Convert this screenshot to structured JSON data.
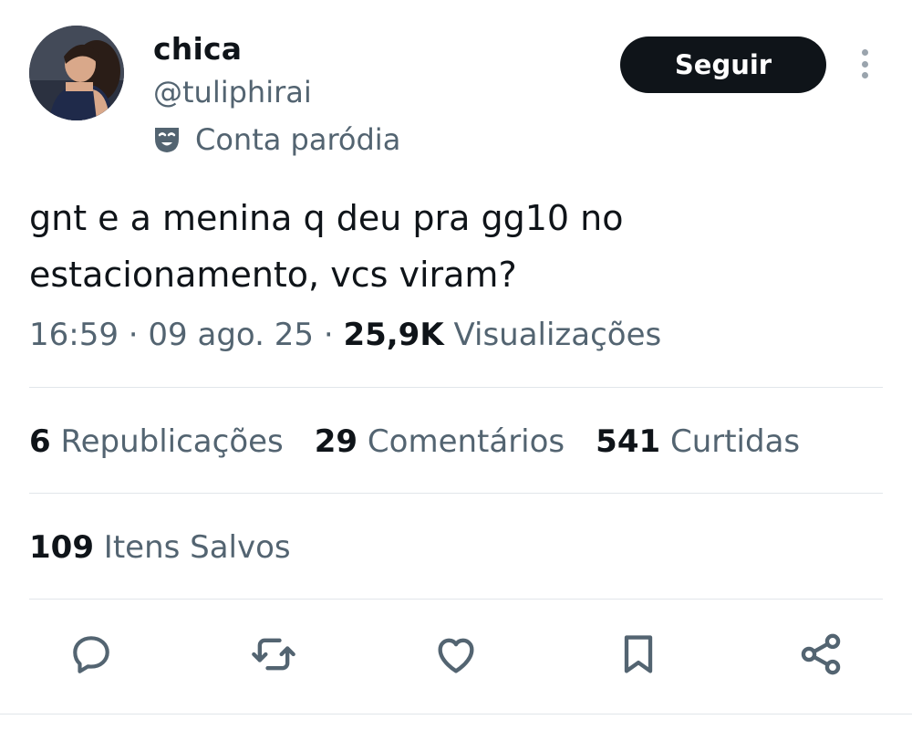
{
  "author": {
    "name": "chica",
    "handle": "@tuliphirai",
    "badge_label": "Conta paródia",
    "badge_icon": "parody-mask-icon"
  },
  "follow_label": "Seguir",
  "more_icon": "more-vertical-icon",
  "tweet": {
    "text": "gnt e a menina q deu pra gg10 no estacionamento, vcs viram?",
    "time": "16:59",
    "date": "09 ago. 25",
    "views_count": "25,9K",
    "views_label": "Visualizações"
  },
  "stats": {
    "reposts_count": "6",
    "reposts_label": "Republicações",
    "comments_count": "29",
    "comments_label": "Comentários",
    "likes_count": "541",
    "likes_label": "Curtidas",
    "saved_count": "109",
    "saved_label": "Itens Salvos"
  },
  "actions": [
    "reply-icon",
    "repost-icon",
    "like-icon",
    "bookmark-icon",
    "share-icon"
  ],
  "colors": {
    "text_primary": "#0f1419",
    "text_secondary": "#536471",
    "button_bg": "#0f1419",
    "divider": "#e1e6ea"
  }
}
